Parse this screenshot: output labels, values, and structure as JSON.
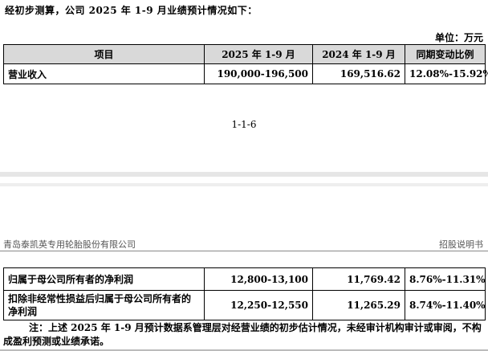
{
  "intro": "经初步测算，公司 2025 年 1-9 月业绩预计情况如下：",
  "unit": "单位：万元",
  "table1": {
    "headers": [
      "项目",
      "2025 年 1-9 月",
      "2024 年 1-9 月",
      "同期变动比例"
    ],
    "rows": [
      {
        "item": "营业收入",
        "y2025": "190,000-196,500",
        "y2024": "169,516.62",
        "change": "12.08%-15.92%"
      }
    ]
  },
  "page_number": "1-1-6",
  "page_header": {
    "company": "青岛泰凯英专用轮胎股份有限公司",
    "doc": "招股说明书"
  },
  "table2": {
    "rows": [
      {
        "item": "归属于母公司所有者的净利润",
        "y2025": "12,800-13,100",
        "y2024": "11,769.42",
        "change": "8.76%-11.31%"
      },
      {
        "item": "扣除非经常性损益后归属于母公司所有者的净利润",
        "y2025": "12,250-12,550",
        "y2024": "11,265.29",
        "change": "8.74%-11.40%"
      }
    ]
  },
  "note": "注：上述 2025 年 1-9 月预计数据系管理层对经营业绩的初步估计情况，未经审计机构审计或审阅，不构成盈利预测或业绩承诺。"
}
